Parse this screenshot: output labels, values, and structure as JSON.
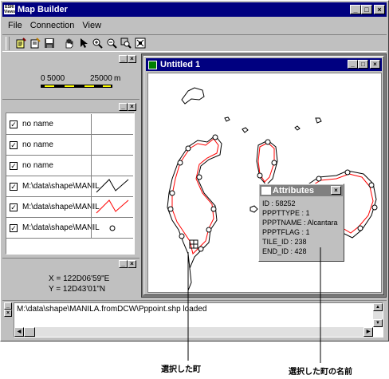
{
  "app": {
    "title": "Map Builder",
    "logo": "ESRI Views"
  },
  "menu": [
    "File",
    "Connection",
    "View"
  ],
  "toolbar": [
    "new-map-icon",
    "open-icon",
    "save-icon",
    "pan-hand-icon",
    "select-arrow-icon",
    "zoom-in-icon",
    "zoom-out-icon",
    "zoom-extent-icon",
    "full-extent-icon"
  ],
  "scale": {
    "left": "0",
    "mid": "5000",
    "right": "25000",
    "unit": "m"
  },
  "layers": [
    {
      "name": "no name",
      "checked": true,
      "symbol": "none"
    },
    {
      "name": "no name",
      "checked": true,
      "symbol": "none"
    },
    {
      "name": "no name",
      "checked": true,
      "symbol": "none"
    },
    {
      "name": "M:\\data\\shape\\MANIL",
      "checked": true,
      "symbol": "black-line"
    },
    {
      "name": "M:\\data\\shape\\MANIL",
      "checked": true,
      "symbol": "red-line"
    },
    {
      "name": "M:\\data\\shape\\MANIL",
      "checked": true,
      "symbol": "point"
    }
  ],
  "coords": {
    "x": "X = 122D06'59\"E",
    "y": "Y = 12D43'01\"N"
  },
  "map_window": {
    "title": "Untitled 1"
  },
  "attributes": {
    "title": "Attributes",
    "lines": [
      "ID : 58252",
      "PPPTTYPE : 1",
      "PPPTNAME : Alcantara",
      "PPPTFLAG : 1",
      "TILE_ID : 238",
      "END_ID : 428"
    ]
  },
  "status": {
    "message": "M:\\data\\shape\\MANILA.fromDCW\\Pppoint.shp loaded"
  },
  "captions": {
    "selected_town": "選択した町",
    "selected_town_name": "選択した町の名前"
  },
  "colors": {
    "titlebar": "#000080",
    "face": "#c0c0c0",
    "red_line": "#ff0000",
    "scale_yellow": "#ffff00"
  }
}
